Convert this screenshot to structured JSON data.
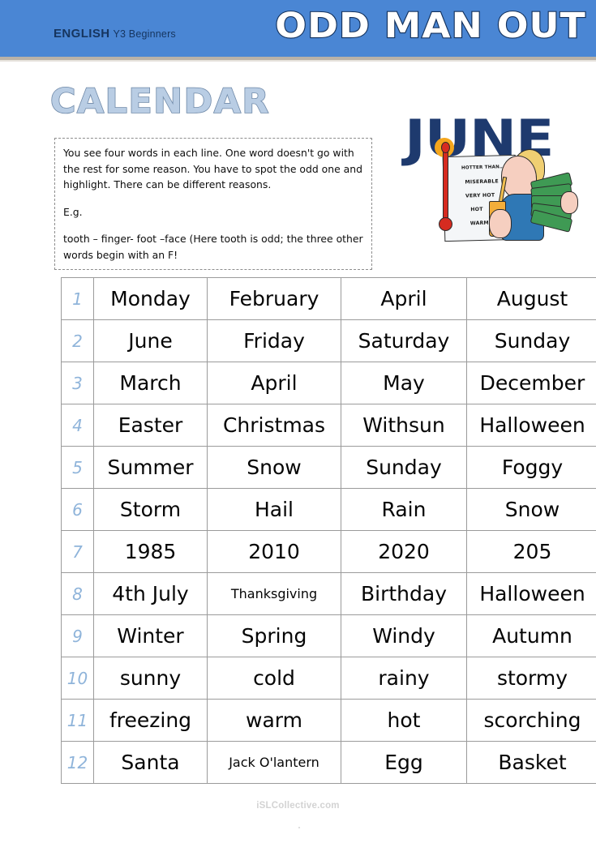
{
  "header": {
    "course_strong": "ENGLISH",
    "course_light": "Y3 Beginners",
    "worksheet_title": "ODD MAN OUT"
  },
  "section": {
    "title": "CALENDAR"
  },
  "instructions": {
    "paragraph1": "You see four words in each line. One word doesn't go with the rest for some reason. You have to spot the odd one and highlight. There can be different reasons.",
    "paragraph2": "E.g.",
    "paragraph3": "tooth – finger- foot –face (Here tooth is odd; the three other words begin with an F!"
  },
  "clipart": {
    "month_word": "JUNE",
    "thermometer_labels": [
      "HOTTER THAN…",
      "MISERABLE",
      "VERY HOT",
      "HOT",
      "WARM"
    ]
  },
  "table": {
    "rows": [
      {
        "num": "1",
        "words": [
          "Monday",
          "February",
          "April",
          "August"
        ]
      },
      {
        "num": "2",
        "words": [
          "June",
          "Friday",
          "Saturday",
          "Sunday"
        ]
      },
      {
        "num": "3",
        "words": [
          "March",
          "April",
          "May",
          "December"
        ]
      },
      {
        "num": "4",
        "words": [
          "Easter",
          "Christmas",
          "Withsun",
          "Halloween"
        ]
      },
      {
        "num": "5",
        "words": [
          "Summer",
          "Snow",
          "Sunday",
          "Foggy"
        ]
      },
      {
        "num": "6",
        "words": [
          "Storm",
          "Hail",
          "Rain",
          "Snow"
        ]
      },
      {
        "num": "7",
        "words": [
          "1985",
          "2010",
          "2020",
          "205"
        ]
      },
      {
        "num": "8",
        "words": [
          "4th July",
          "Thanksgiving",
          "Birthday",
          "Halloween"
        ]
      },
      {
        "num": "9",
        "words": [
          "Winter",
          "Spring",
          "Windy",
          "Autumn"
        ]
      },
      {
        "num": "10",
        "words": [
          "sunny",
          "cold",
          "rainy",
          "stormy"
        ]
      },
      {
        "num": "11",
        "words": [
          "freezing",
          "warm",
          "hot",
          "scorching"
        ]
      },
      {
        "num": "12",
        "words": [
          "Santa",
          "Jack O'lantern",
          "Egg",
          "Basket"
        ]
      }
    ]
  },
  "footer": {
    "watermark": "iSLCollective.com"
  },
  "colors": {
    "header_blue": "#4a86d4",
    "title_navy": "#13315c",
    "calendar_fill": "#b9cde4",
    "row_number_blue": "#8fb4da",
    "june_navy": "#1e3a6e",
    "watermark_gray": "#d3d3d3"
  }
}
